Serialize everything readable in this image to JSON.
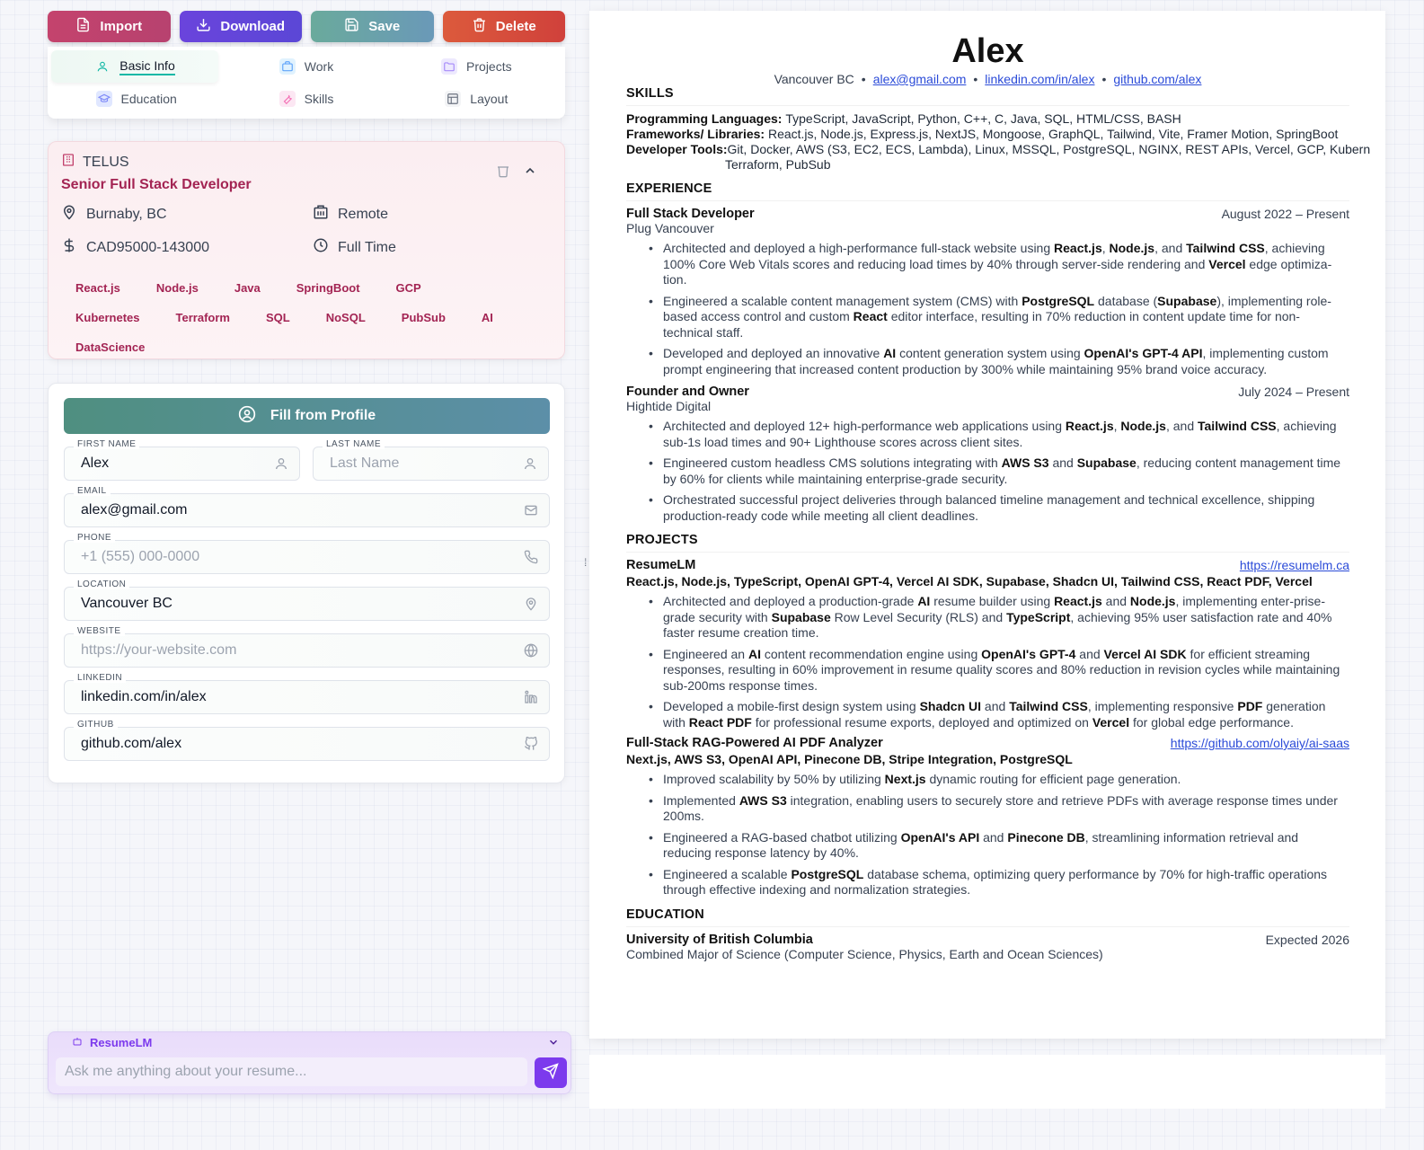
{
  "toolbar": {
    "import_label": "Import",
    "download_label": "Download",
    "save_label": "Save",
    "delete_label": "Delete"
  },
  "tabs": [
    {
      "label": "Basic Info",
      "icon": "user-icon",
      "color": "#14b8a6"
    },
    {
      "label": "Work",
      "icon": "briefcase-icon",
      "color": "#60a5fa"
    },
    {
      "label": "Projects",
      "icon": "folder-icon",
      "color": "#a78bfa"
    },
    {
      "label": "Education",
      "icon": "graduation-cap-icon",
      "color": "#818cf8"
    },
    {
      "label": "Skills",
      "icon": "wrench-icon",
      "color": "#f472b6"
    },
    {
      "label": "Layout",
      "icon": "layout-icon",
      "color": "#6b7280"
    }
  ],
  "work_card": {
    "company": "TELUS",
    "title": "Senior Full Stack Developer",
    "location": "Burnaby, BC",
    "work_mode": "Remote",
    "salary": "CAD95000-143000",
    "employment_type": "Full Time",
    "skills": [
      "React.js",
      "Node.js",
      "Java",
      "SpringBoot",
      "GCP",
      "Kubernetes",
      "Terraform",
      "SQL",
      "NoSQL",
      "PubSub",
      "AI",
      "DataScience"
    ]
  },
  "form": {
    "fill_label": "Fill from Profile",
    "first_name": {
      "label": "FIRST NAME",
      "value": "Alex",
      "placeholder": "First Name"
    },
    "last_name": {
      "label": "LAST NAME",
      "value": "",
      "placeholder": "Last Name"
    },
    "email": {
      "label": "EMAIL",
      "value": "alex@gmail.com",
      "placeholder": "Email"
    },
    "phone": {
      "label": "PHONE",
      "value": "",
      "placeholder": "+1 (555) 000-0000"
    },
    "location": {
      "label": "LOCATION",
      "value": "Vancouver BC",
      "placeholder": "Location"
    },
    "website": {
      "label": "WEBSITE",
      "value": "",
      "placeholder": "https://your-website.com"
    },
    "linkedin": {
      "label": "LINKEDIN",
      "value": "linkedin.com/in/alex",
      "placeholder": "LinkedIn"
    },
    "github": {
      "label": "GITHUB",
      "value": "github.com/alex",
      "placeholder": "GitHub"
    }
  },
  "chat": {
    "title": "ResumeLM",
    "placeholder": "Ask me anything about your resume..."
  },
  "resume": {
    "name": "Alex",
    "location": "Vancouver BC",
    "email": "alex@gmail.com",
    "linkedin": "linkedin.com/in/alex",
    "github": "github.com/alex",
    "skills_heading": "SKILLS",
    "skills": {
      "lang_label": "Programming Languages:",
      "lang_value": "TypeScript, JavaScript, Python, C++, C, Java, SQL, HTML/CSS, BASH",
      "fw_label": "Frameworks/ Libraries:",
      "fw_value": "React.js, Node.js, Express.js, NextJS, Mongoose, GraphQL, Tailwind, Vite, Framer Motion, SpringBoot",
      "tools_label": "Developer Tools:",
      "tools_value": "Git, Docker, AWS (S3, EC2, ECS, Lambda), Linux, MSSQL, PostgreSQL, NGINX, REST APIs, Vercel, GCP, Kubern",
      "tools_value_2": "Terraform, PubSub"
    },
    "experience_heading": "EXPERIENCE",
    "experience": [
      {
        "title": "Full Stack Developer",
        "date": "August 2022 – Present",
        "company": "Plug Vancouver"
      },
      {
        "title": "Founder and Owner",
        "date": "July 2024 – Present",
        "company": "Hightide Digital"
      }
    ],
    "projects_heading": "PROJECTS",
    "projects": [
      {
        "name": "ResumeLM",
        "link": "https://resumelm.ca",
        "tech": "React.js, Node.js, TypeScript, OpenAI GPT-4, Vercel AI SDK, Supabase, Shadcn UI, Tailwind CSS, React PDF, Vercel"
      },
      {
        "name": "Full-Stack RAG-Powered AI PDF Analyzer",
        "link": "https://github.com/olyaiy/ai-saas",
        "tech": "Next.js, AWS S3, OpenAI API, Pinecone DB, Stripe Integration, PostgreSQL"
      }
    ],
    "education_heading": "EDUCATION",
    "education": {
      "school": "University of British Columbia",
      "date": "Expected 2026",
      "degree": "Combined Major of Science (Computer Science, Physics, Earth and Ocean Sciences)"
    }
  }
}
